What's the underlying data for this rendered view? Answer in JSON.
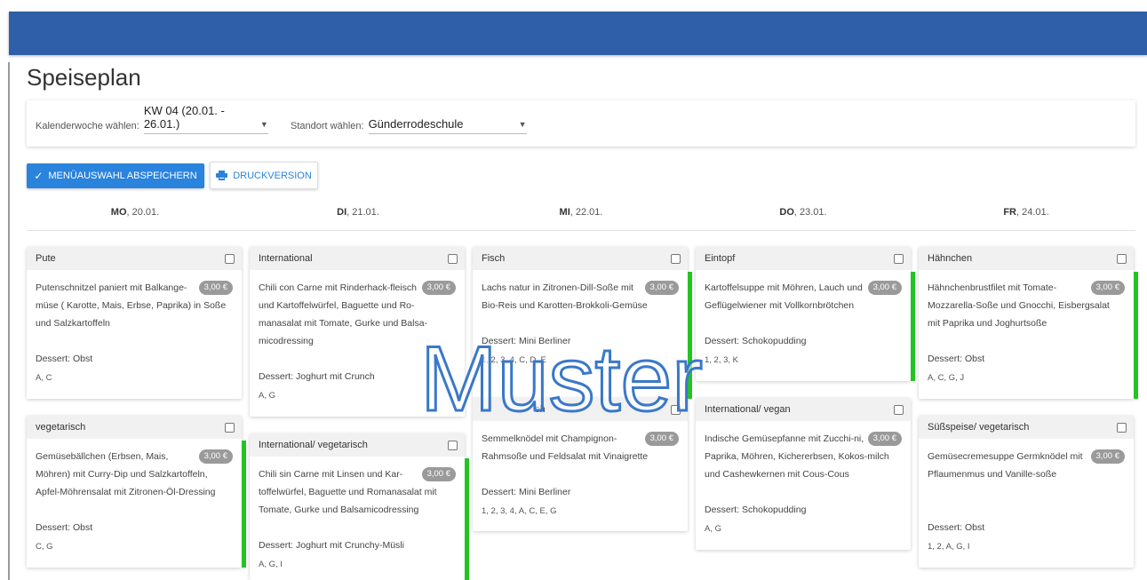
{
  "page": {
    "title": "Speiseplan"
  },
  "filters": {
    "week_label": "Kalenderwoche wählen:",
    "week_value": "KW 04 (20.01. - 26.01.)",
    "location_label": "Standort wählen:",
    "location_value": "Günderrodeschule"
  },
  "actions": {
    "save_label": "MENÜAUSWAHL ABSPEICHERN",
    "print_label": "DRUCKVERSION"
  },
  "days": [
    {
      "abbr": "MO",
      "date": ", 20.01."
    },
    {
      "abbr": "DI",
      "date": ", 21.01."
    },
    {
      "abbr": "MI",
      "date": ", 22.01."
    },
    {
      "abbr": "DO",
      "date": ", 23.01."
    },
    {
      "abbr": "FR",
      "date": ", 24.01."
    }
  ],
  "menus": {
    "mo": [
      {
        "category": "Pute",
        "description": "Putenschnitzel paniert mit Balkange-müse ( Karotte, Mais, Erbse, Paprika) in Soße und Salzkartoffeln",
        "price": "3,00 €",
        "dessert": "Dessert: Obst",
        "codes": "A, C",
        "selected": false
      },
      {
        "category": "vegetarisch",
        "description": "Gemüsebällchen (Erbsen, Mais, Möhren) mit Curry-Dip und Salzkartoffeln, Apfel-Möhrensalat mit Zitronen-Öl-Dressing",
        "price": "3,00 €",
        "dessert": "Dessert: Obst",
        "codes": "C, G",
        "selected": true
      }
    ],
    "di": [
      {
        "category": "International",
        "description": "Chili con Carne mit Rinderhack-fleisch und Kartoffelwürfel, Baguette und Ro-manasalat mit Tomate, Gurke und Balsa-micodressing",
        "price": "3,00 €",
        "dessert": "Dessert: Joghurt mit Crunch",
        "codes": "A, G",
        "selected": false
      },
      {
        "category": "International/ vegetarisch",
        "description": "Chili sin Carne mit Linsen und Kar-toffelwürfel, Baguette und Romanasalat mit Tomate, Gurke und Balsamicodressing",
        "price": "3,00 €",
        "dessert": "Dessert: Joghurt mit Crunchy-Müsli",
        "codes": "A, G, I",
        "selected": true
      }
    ],
    "mi": [
      {
        "category": "Fisch",
        "description": "Lachs natur in Zitronen-Dill-Soße mit Bio-Reis und Karotten-Brokkoli-Gemüse",
        "price": "3,00 €",
        "dessert": "Dessert: Mini Berliner",
        "codes": "1, 2, 3, 4, C, D, E",
        "selected": true
      },
      {
        "category": "ch",
        "description": "Semmelknödel mit Champignon-Rahmsoße und Feldsalat mit Vinaigrette",
        "price": "3,00 €",
        "dessert": "Dessert: Mini Berliner",
        "codes": "1, 2, 3, 4, A, C, E, G",
        "selected": false
      }
    ],
    "do": [
      {
        "category": "Eintopf",
        "description": "Kartoffelsuppe mit Möhren, Lauch und Geflügelwiener mit Vollkornbrötchen",
        "price": "3,00 €",
        "dessert": "Dessert: Schokopudding",
        "codes": "1, 2, 3, K",
        "selected": true
      },
      {
        "category": "International/ vegan",
        "description": "Indische Gemüsepfanne mit Zucchi-ni, Paprika, Möhren, Kichererbsen, Kokos-milch und Cashewkernen mit Cous-Cous",
        "price": "3,00 €",
        "dessert": "Dessert: Schokopudding",
        "codes": "A, G",
        "selected": false
      }
    ],
    "fr": [
      {
        "category": "Hähnchen",
        "description": "Hähnchenbrustfilet mit Tomate-Mozzarella-Soße und Gnocchi, Eisbergsalat mit Paprika und Joghurtsoße",
        "price": "3,00 €",
        "dessert": "Dessert: Obst",
        "codes": "A, C, G, J",
        "selected": true
      },
      {
        "category": "Süßspeise/ vegetarisch",
        "description": "Gemüsecremesuppe Germknödel mit Pflaumenmus und Vanille-soße",
        "price": "3,00 €",
        "dessert": "Dessert: Obst",
        "codes": "1, 2, A, G, I",
        "selected": false
      }
    ]
  },
  "watermark": {
    "text": "Muster"
  },
  "colors": {
    "header": "#2f5fa8",
    "primary": "#2a83dd",
    "selected_bar": "#22c422"
  },
  "icons": {
    "check": "check-icon",
    "printer": "printer-icon",
    "dropdown": "caret-down-icon"
  }
}
